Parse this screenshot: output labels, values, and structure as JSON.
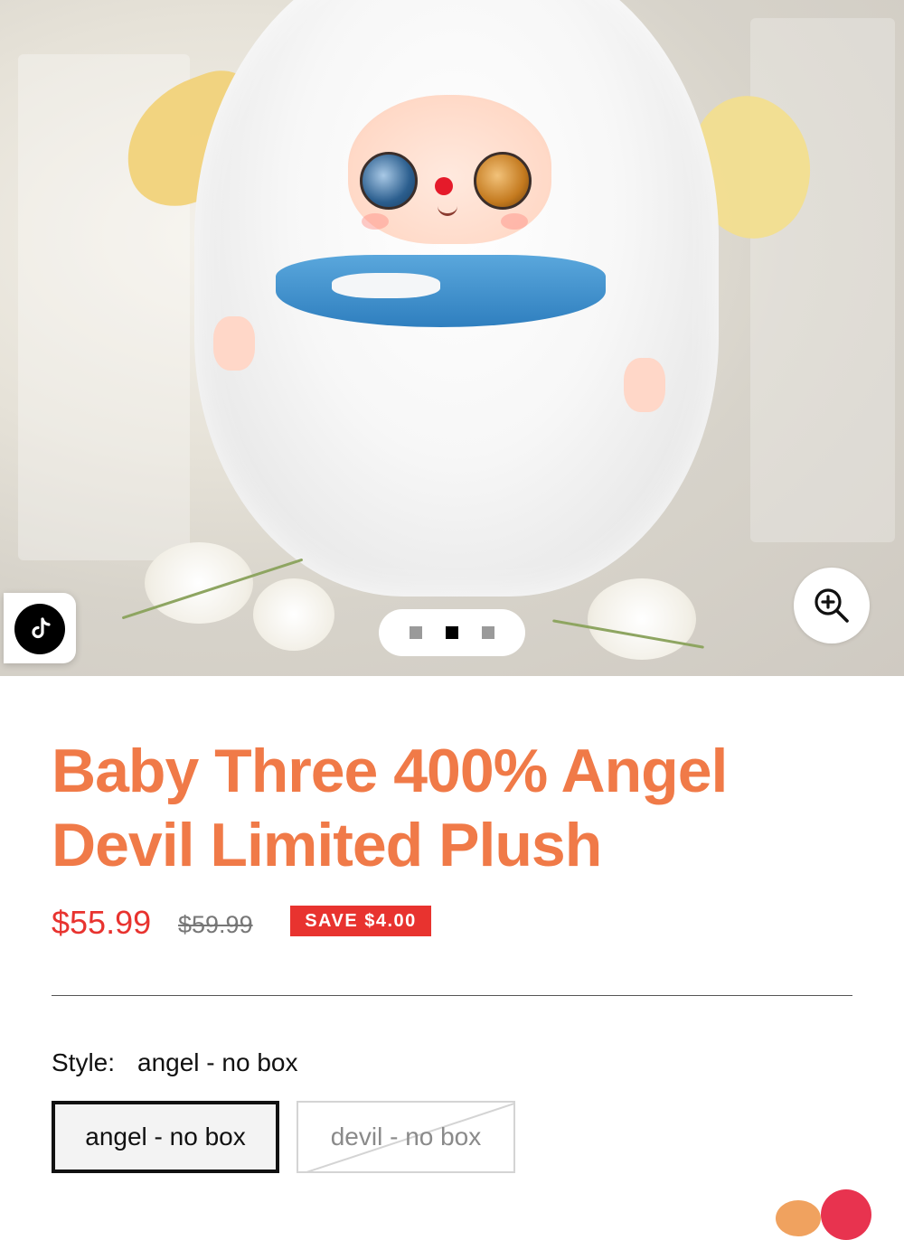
{
  "gallery": {
    "image_alt": "Baby Three 400% Angel Devil Limited Plush",
    "slide_count": 3,
    "active_slide": 2,
    "zoom_icon": "zoom-in-icon",
    "tiktok_icon": "tiktok-icon"
  },
  "product": {
    "title": "Baby Three 400% Angel Devil Limited Plush",
    "price": "$55.99",
    "compare_price": "$59.99",
    "save_badge": "SAVE $4.00"
  },
  "variants": {
    "label": "Style:",
    "selected_value": "angel - no box",
    "options": [
      {
        "label": "angel - no box",
        "state": "selected"
      },
      {
        "label": "devil - no box",
        "state": "unavailable"
      }
    ]
  },
  "colors": {
    "title": "#f07a48",
    "price": "#e8332f",
    "badge": "#e8332f"
  }
}
